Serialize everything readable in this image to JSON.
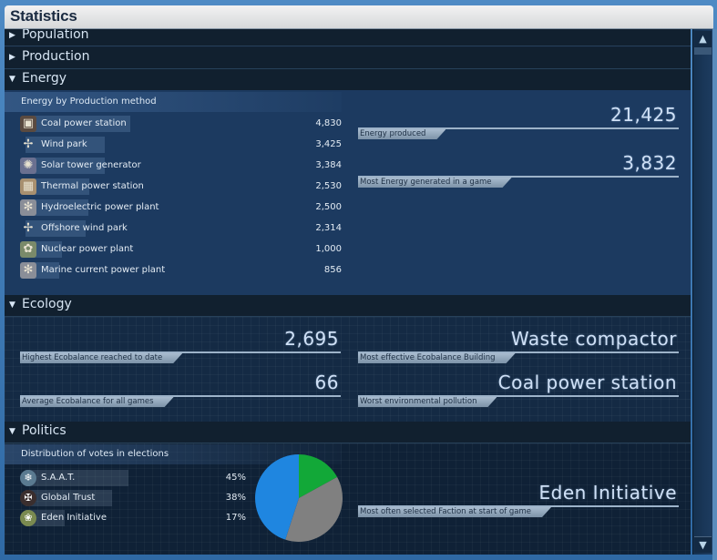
{
  "window": {
    "title": "Statistics"
  },
  "sections": {
    "population": {
      "label": "Population",
      "expanded": false
    },
    "production": {
      "label": "Production",
      "expanded": false
    },
    "energy": {
      "label": "Energy",
      "expanded": true
    },
    "ecology": {
      "label": "Ecology",
      "expanded": true
    },
    "politics": {
      "label": "Politics",
      "expanded": true
    }
  },
  "energy": {
    "subheader": "Energy by Production method",
    "items": [
      {
        "name": "Coal power station",
        "value": "4,830",
        "num": 4830,
        "icon": "coal-power-station-icon",
        "glyph": "▣",
        "color": "#5a4a40"
      },
      {
        "name": "Wind park",
        "value": "3,425",
        "num": 3425,
        "icon": "wind-park-icon",
        "glyph": "✢",
        "color": "transparent"
      },
      {
        "name": "Solar tower generator",
        "value": "3,384",
        "num": 3384,
        "icon": "solar-tower-icon",
        "glyph": "✺",
        "color": "#6a7090"
      },
      {
        "name": "Thermal power station",
        "value": "2,530",
        "num": 2530,
        "icon": "thermal-power-station-icon",
        "glyph": "▦",
        "color": "#a89070"
      },
      {
        "name": "Hydroelectric power plant",
        "value": "2,500",
        "num": 2500,
        "icon": "hydroelectric-plant-icon",
        "glyph": "✻",
        "color": "#8a8e98"
      },
      {
        "name": "Offshore wind park",
        "value": "2,314",
        "num": 2314,
        "icon": "offshore-wind-park-icon",
        "glyph": "✢",
        "color": "transparent"
      },
      {
        "name": "Nuclear power plant",
        "value": "1,000",
        "num": 1000,
        "icon": "nuclear-power-plant-icon",
        "glyph": "✿",
        "color": "#7a8a6a"
      },
      {
        "name": "Marine current power plant",
        "value": "856",
        "num": 856,
        "icon": "marine-current-plant-icon",
        "glyph": "✻",
        "color": "#8a8e98"
      }
    ],
    "stats": [
      {
        "value": "21,425",
        "caption": "Energy produced"
      },
      {
        "value": "3,832",
        "caption": "Most Energy generated in a game"
      }
    ]
  },
  "ecology": {
    "stats": [
      {
        "value": "2,695",
        "caption": "Highest Ecobalance reached to date"
      },
      {
        "value": "Waste compactor",
        "caption": "Most effective Ecobalance Building"
      },
      {
        "value": "66",
        "caption": "Average Ecobalance for all games"
      },
      {
        "value": "Coal power station",
        "caption": "Worst environmental pollution"
      }
    ]
  },
  "politics": {
    "subheader": "Distribution of votes in elections",
    "factions": [
      {
        "name": "S.A.A.T.",
        "pct": "45%",
        "share": 45,
        "icon": "saat-faction-icon",
        "glyph": "❄",
        "color": "#1f86e0",
        "iconBg": "#5a7a90"
      },
      {
        "name": "Global Trust",
        "pct": "38%",
        "share": 38,
        "icon": "global-trust-faction-icon",
        "glyph": "✠",
        "color": "#808080",
        "iconBg": "#3a2e2e"
      },
      {
        "name": "Eden Initiative",
        "pct": "17%",
        "share": 17,
        "icon": "eden-initiative-faction-icon",
        "glyph": "❀",
        "color": "#12a838",
        "iconBg": "#7a8a50"
      }
    ],
    "stats": [
      {
        "value": "Eden Initiative",
        "caption": "Most often selected Faction at start of game"
      }
    ]
  },
  "chart_data": {
    "type": "pie",
    "title": "Distribution of votes in elections",
    "categories": [
      "Eden Initiative",
      "Global Trust",
      "S.A.A.T."
    ],
    "values": [
      17,
      38,
      45
    ],
    "colors": [
      "#12a838",
      "#808080",
      "#1f86e0"
    ],
    "start": "12 o'clock, clockwise"
  },
  "scrollbar": {
    "up_glyph": "▲",
    "down_glyph": "▼"
  },
  "arrows": {
    "collapsed": "▶",
    "expanded": "▼"
  }
}
